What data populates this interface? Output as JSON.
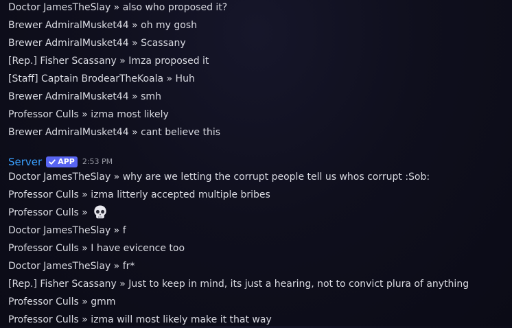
{
  "messages_before": [
    "Doctor JamesTheSlay » also who proposed it?",
    "Brewer AdmiralMusket44 » oh my gosh",
    "Brewer AdmiralMusket44 » Scassany",
    "[Rep.] Fisher Scassany » Imza proposed it",
    "[Staff] Captain BrodearTheKoala » Huh",
    "Brewer AdmiralMusket44 » smh",
    "Professor Culls » izma most likely",
    "Brewer AdmiralMusket44 » cant believe this"
  ],
  "group": {
    "author": "Server",
    "badge": "APP",
    "timestamp": "2:53 PM",
    "author_color": "#3aa0ff",
    "badge_color": "#5865f2"
  },
  "messages_after": [
    "Doctor JamesTheSlay » why are we letting the corrupt people tell us whos corrupt :Sob:",
    "Professor Culls » izma litterly accepted multiple bribes",
    "Professor Culls » ",
    "Doctor JamesTheSlay » f",
    "Professor Culls » I have evicence too",
    "Doctor JamesTheSlay » fr*",
    "[Rep.] Fisher Scassany » Just to keep in mind, its just a hearing, not to convict plura of anything",
    "Professor Culls » gmm",
    "Professor Culls » izma will most likely make it that way"
  ],
  "emoji": {
    "name": "skull-emoji"
  }
}
